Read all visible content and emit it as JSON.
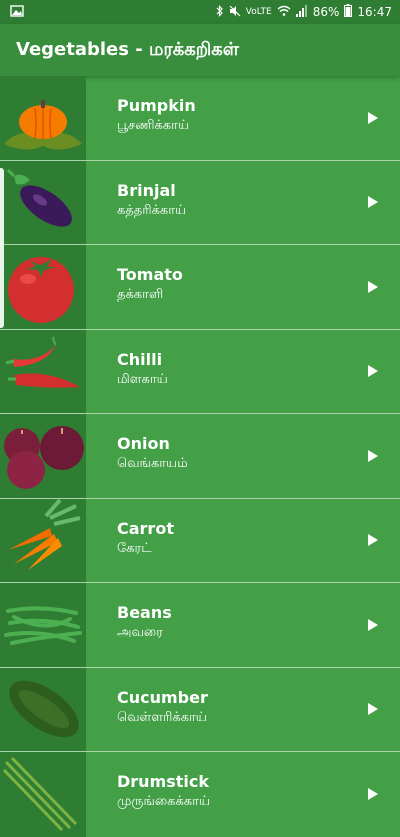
{
  "status_bar": {
    "icons": [
      "image-icon",
      "bluetooth-icon",
      "mute-icon",
      "volte-icon",
      "wifi-icon",
      "signal-icon",
      "battery-icon"
    ],
    "volte": "VoLTE",
    "battery": "86%",
    "time": "16:47"
  },
  "app_bar": {
    "title": "Vegetables - மரக்கறிகள்"
  },
  "items": [
    {
      "en": "Pumpkin",
      "ta": "பூசணிக்காய்",
      "image": "pumpkin"
    },
    {
      "en": "Brinjal",
      "ta": "கத்தரிக்காய்",
      "image": "brinjal"
    },
    {
      "en": "Tomato",
      "ta": "தக்காளி",
      "image": "tomato"
    },
    {
      "en": "Chilli",
      "ta": "மிளகாய்",
      "image": "chilli"
    },
    {
      "en": "Onion",
      "ta": "வெங்காயம்",
      "image": "onion"
    },
    {
      "en": "Carrot",
      "ta": "கேரட்",
      "image": "carrot"
    },
    {
      "en": "Beans",
      "ta": "அவரை",
      "image": "beans"
    },
    {
      "en": "Cucumber",
      "ta": "வெள்ளரிக்காய்",
      "image": "cucumber"
    },
    {
      "en": "Drumstick",
      "ta": "முருங்கைக்காய்",
      "image": "drumstick"
    }
  ],
  "colors": {
    "background": "#43a047",
    "app_bar": "#388e3c",
    "status_bar": "#2e7d32",
    "thumb_bg": "#2e7d32"
  }
}
